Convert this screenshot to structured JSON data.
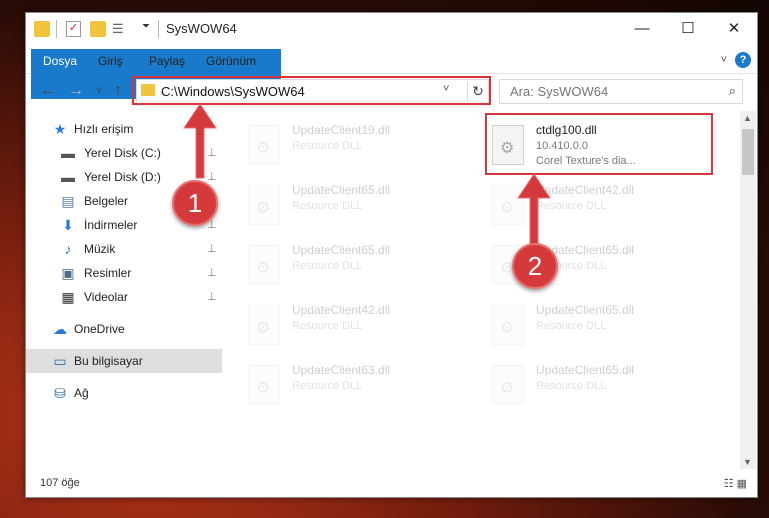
{
  "window": {
    "title": "SysWOW64",
    "controls": {
      "minimize": "—",
      "maximize": "☐",
      "close": "✕"
    }
  },
  "ribbon": {
    "tabs": [
      "Dosya",
      "Giriş",
      "Paylaş",
      "Görünüm"
    ],
    "help": "?",
    "expand": "˅"
  },
  "nav": {
    "back": "←",
    "forward": "→",
    "recent": "˅",
    "up": "↑",
    "address": "C:\\Windows\\SysWOW64",
    "dropdown": "˅",
    "refresh": "↻",
    "search_placeholder": "Ara: SysWOW64",
    "search_icon": "⌕"
  },
  "sidebar": {
    "items": [
      {
        "label": "Hızlı erişim",
        "icon": "★",
        "pinned": false
      },
      {
        "label": "Yerel Disk (C:)",
        "icon": "▬",
        "pinned": true
      },
      {
        "label": "Yerel Disk (D:)",
        "icon": "▬",
        "pinned": true
      },
      {
        "label": "Belgeler",
        "icon": "▤",
        "pinned": true
      },
      {
        "label": "İndirmeler",
        "icon": "⬇",
        "pinned": true
      },
      {
        "label": "Müzik",
        "icon": "♪",
        "pinned": true
      },
      {
        "label": "Resimler",
        "icon": "▣",
        "pinned": true
      },
      {
        "label": "Videolar",
        "icon": "▦",
        "pinned": true
      },
      {
        "label": "OneDrive",
        "icon": "☁",
        "pinned": false
      },
      {
        "label": "Bu bilgisayar",
        "icon": "▭",
        "pinned": false
      },
      {
        "label": "Ağ",
        "icon": "⛁",
        "pinned": false
      }
    ],
    "pin_glyph": "📌"
  },
  "files": [
    {
      "name": "UpdateClient19.dll",
      "sub": "Resource DLL"
    },
    {
      "name": "ctdlg100.dll",
      "sub": "10.410.0.0",
      "sub2": "Corel Texture's dia..."
    },
    {
      "name": "UpdateClient65.dll",
      "sub": "Resource DLL"
    },
    {
      "name": "UpdateClient42.dll",
      "sub": "Resource DLL"
    },
    {
      "name": "UpdateClient65.dll",
      "sub": "Resource DLL"
    },
    {
      "name": "UpdateClient65.dll",
      "sub": "Resource DLL"
    },
    {
      "name": "UpdateClient42.dll",
      "sub": "Resource DLL"
    },
    {
      "name": "UpdateClient65.dll",
      "sub": "Resource DLL"
    },
    {
      "name": "UpdateClient63.dll",
      "sub": "Resource DLL"
    },
    {
      "name": "UpdateClient65.dll",
      "sub": "Resource DLL"
    }
  ],
  "status": {
    "count": "107 öğe",
    "views": "☷ ▦"
  },
  "annotations": {
    "badge1": "1",
    "badge2": "2",
    "color": "#d9343a"
  }
}
